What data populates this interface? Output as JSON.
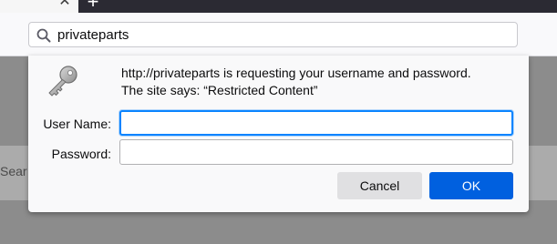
{
  "tabbar": {
    "close_glyph": "✕",
    "new_tab_glyph": "+"
  },
  "urlbar": {
    "icon": "search-icon",
    "text": "privateparts"
  },
  "page": {
    "peek_text": "Sear"
  },
  "dialog": {
    "icon": "key-icon",
    "message_line1": "http://privateparts is requesting your username and password.",
    "message_line2": "The site says: “Restricted Content”",
    "username_label": "User Name:",
    "username_value": "",
    "password_label": "Password:",
    "password_value": "",
    "cancel_label": "Cancel",
    "ok_label": "OK"
  },
  "colors": {
    "accent": "#0a84ff",
    "ok_button": "#0060df",
    "cancel_button": "#e0e0e2",
    "overlay": "#8c8c8c"
  }
}
